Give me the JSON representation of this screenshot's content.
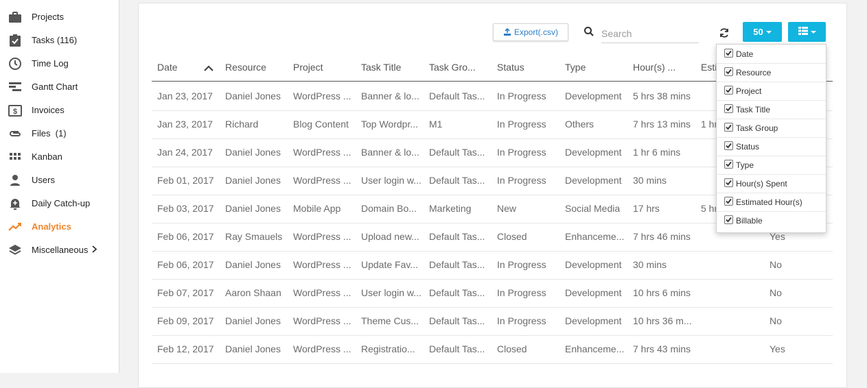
{
  "sidebar": {
    "items": [
      {
        "label": "Projects",
        "icon": "briefcase-icon"
      },
      {
        "label": "Tasks (116)",
        "icon": "clipboard-check-icon"
      },
      {
        "label": "Time Log",
        "icon": "clock-icon"
      },
      {
        "label": "Gantt Chart",
        "icon": "gantt-icon"
      },
      {
        "label": "Invoices",
        "icon": "invoice-dollar-icon"
      },
      {
        "label": "Files  (1)",
        "icon": "paperclip-icon"
      },
      {
        "label": "Kanban",
        "icon": "grid-icon"
      },
      {
        "label": "Users",
        "icon": "user-icon"
      },
      {
        "label": "Daily Catch-up",
        "icon": "bell-add-icon"
      },
      {
        "label": "Analytics",
        "icon": "trending-icon",
        "active": true
      },
      {
        "label": "Miscellaneous",
        "icon": "layers-icon"
      }
    ],
    "accent_color": "#f0862b"
  },
  "toolbar": {
    "export_label": "Export(.csv)",
    "search_placeholder": "Search",
    "page_size": "50",
    "button_color": "#12b5e0"
  },
  "table": {
    "columns": [
      "Date",
      "Resource",
      "Project",
      "Task Title",
      "Task Gro...",
      "Status",
      "Type",
      "Hour(s) ...",
      "Esti"
    ],
    "rows": [
      [
        "Jan 23, 2017",
        "Daniel Jones",
        "WordPress ...",
        "Banner & lo...",
        "Default Tas...",
        "In Progress",
        "Development",
        "5 hrs 38 mins",
        "",
        ""
      ],
      [
        "Jan 23, 2017",
        "Richard",
        "Blog Content",
        "Top Wordpr...",
        "M1",
        "In Progress",
        "Others",
        "7 hrs 13 mins",
        "1 hr",
        ""
      ],
      [
        "Jan 24, 2017",
        "Daniel Jones",
        "WordPress ...",
        "Banner & lo...",
        "Default Tas...",
        "In Progress",
        "Development",
        "1 hr 6 mins",
        "",
        ""
      ],
      [
        "Feb 01, 2017",
        "Daniel Jones",
        "WordPress ...",
        "User login w...",
        "Default Tas...",
        "In Progress",
        "Development",
        "30 mins",
        "",
        ""
      ],
      [
        "Feb 03, 2017",
        "Daniel Jones",
        "Mobile App",
        "Domain Bo...",
        "Marketing",
        "New",
        "Social Media",
        "17 hrs",
        "5 hr",
        ""
      ],
      [
        "Feb 06, 2017",
        "Ray Smauels",
        "WordPress ...",
        "Upload new...",
        "Default Tas...",
        "Closed",
        "Enhanceme...",
        "7 hrs 46 mins",
        "",
        "Yes"
      ],
      [
        "Feb 06, 2017",
        "Daniel Jones",
        "WordPress ...",
        "Update Fav...",
        "Default Tas...",
        "In Progress",
        "Development",
        "30 mins",
        "",
        "No"
      ],
      [
        "Feb 07, 2017",
        "Aaron Shaan",
        "WordPress ...",
        "User login w...",
        "Default Tas...",
        "In Progress",
        "Development",
        "10 hrs 6 mins",
        "",
        "No"
      ],
      [
        "Feb 09, 2017",
        "Daniel Jones",
        "WordPress ...",
        "Theme Cus...",
        "Default Tas...",
        "In Progress",
        "Development",
        "10 hrs 36 m...",
        "",
        "No"
      ],
      [
        "Feb 12, 2017",
        "Daniel Jones",
        "WordPress ...",
        "Registratio...",
        "Default Tas...",
        "Closed",
        "Enhanceme...",
        "7 hrs 43 mins",
        "",
        "Yes"
      ]
    ]
  },
  "column_menu": {
    "items": [
      "Date",
      "Resource",
      "Project",
      "Task Title",
      "Task Group",
      "Status",
      "Type",
      "Hour(s) Spent",
      "Estimated Hour(s)",
      "Billable"
    ]
  }
}
